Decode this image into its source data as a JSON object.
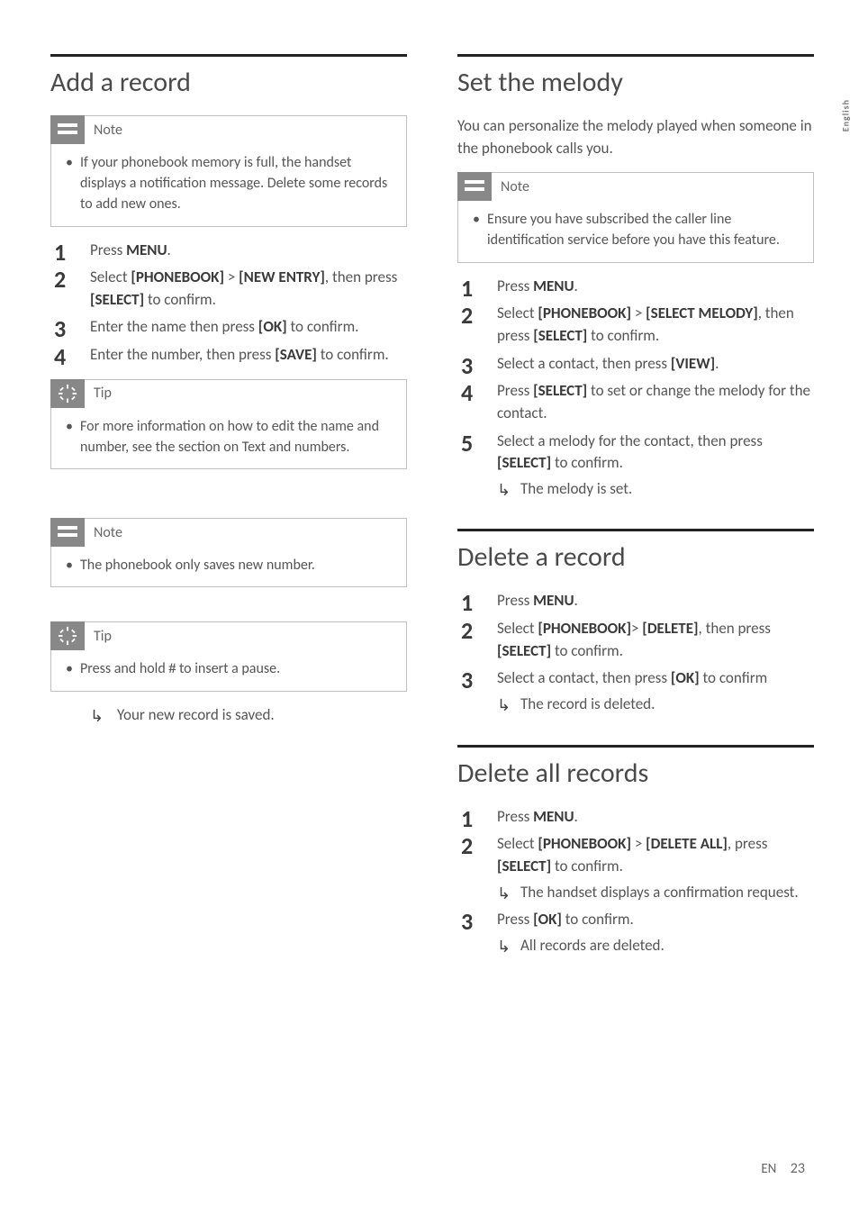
{
  "sideLabel": "English",
  "left": {
    "h1": "Add a record",
    "note1": {
      "label": "Note",
      "items": [
        "If your phonebook memory is full, the handset displays a notification message. Delete some records to add new ones."
      ]
    },
    "steps": [
      {
        "pre": "Press ",
        "b1": "MENU",
        "post": "."
      },
      {
        "pre": "Select ",
        "b1": "[PHONEBOOK]",
        "mid1": " > ",
        "b2": "[NEW ENTRY]",
        "mid2": ", then press ",
        "b3": "[SELECT]",
        "post": " to confirm."
      },
      {
        "pre": "Enter the name then press ",
        "b1": "[OK]",
        "post": " to confirm."
      },
      {
        "pre": "Enter the number, then press ",
        "b1": "[SAVE]",
        "post": " to confirm."
      }
    ],
    "tip1": {
      "label": "Tip",
      "items": [
        "For more information on how to edit the name and number, see the section on Text and numbers."
      ]
    },
    "note2": {
      "label": "Note",
      "items": [
        "The phonebook only saves new number."
      ]
    },
    "tip2": {
      "label": "Tip",
      "item_pre": "Press and hold ",
      "item_post": " to insert a pause."
    },
    "result": "Your new record is saved."
  },
  "right": {
    "sec1": {
      "h": "Set the melody",
      "intro": "You can personalize the melody played when someone in the phonebook calls you.",
      "note": {
        "label": "Note",
        "items": [
          "Ensure you have subscribed the caller line identification service before you have this feature."
        ]
      },
      "steps": [
        {
          "pre": "Press ",
          "b1": "MENU",
          "post": "."
        },
        {
          "pre": "Select ",
          "b1": "[PHONEBOOK]",
          "mid1": " > ",
          "b2": "[SELECT MELODY]",
          "mid2": ", then press ",
          "b3": "[SELECT]",
          "post": " to confirm."
        },
        {
          "pre": "Select a contact, then press ",
          "b1": "[VIEW]",
          "post": "."
        },
        {
          "pre": "Press ",
          "b1": "[SELECT]",
          "post": " to set or change the melody for the contact."
        },
        {
          "pre": "Select a melody for the contact, then press ",
          "b1": "[SELECT]",
          "post": " to confirm.",
          "result": "The melody is set."
        }
      ]
    },
    "sec2": {
      "h": "Delete a record",
      "steps": [
        {
          "pre": "Press ",
          "b1": "MENU",
          "post": "."
        },
        {
          "pre": "Select ",
          "b1": "[PHONEBOOK]",
          "mid1": "> ",
          "b2": "[DELETE]",
          "mid2": ", then press ",
          "b3": "[SELECT]",
          "post": " to confirm."
        },
        {
          "pre": "Select a contact, then press ",
          "b1": "[OK]",
          "post": " to confirm",
          "result": "The record is deleted."
        }
      ]
    },
    "sec3": {
      "h": "Delete all records",
      "steps": [
        {
          "pre": "Press ",
          "b1": "MENU",
          "post": "."
        },
        {
          "pre": "Select ",
          "b1": "[PHONEBOOK]",
          "mid1": " > ",
          "b2": "[DELETE ALL]",
          "mid2": ", press ",
          "b3": "[SELECT]",
          "post": " to confirm.",
          "result": "The handset displays a confirmation request."
        },
        {
          "pre": "Press ",
          "b1": "[OK]",
          "post": " to confirm.",
          "result": "All records are deleted."
        }
      ]
    }
  },
  "footer": {
    "lang": "EN",
    "page": "23"
  }
}
